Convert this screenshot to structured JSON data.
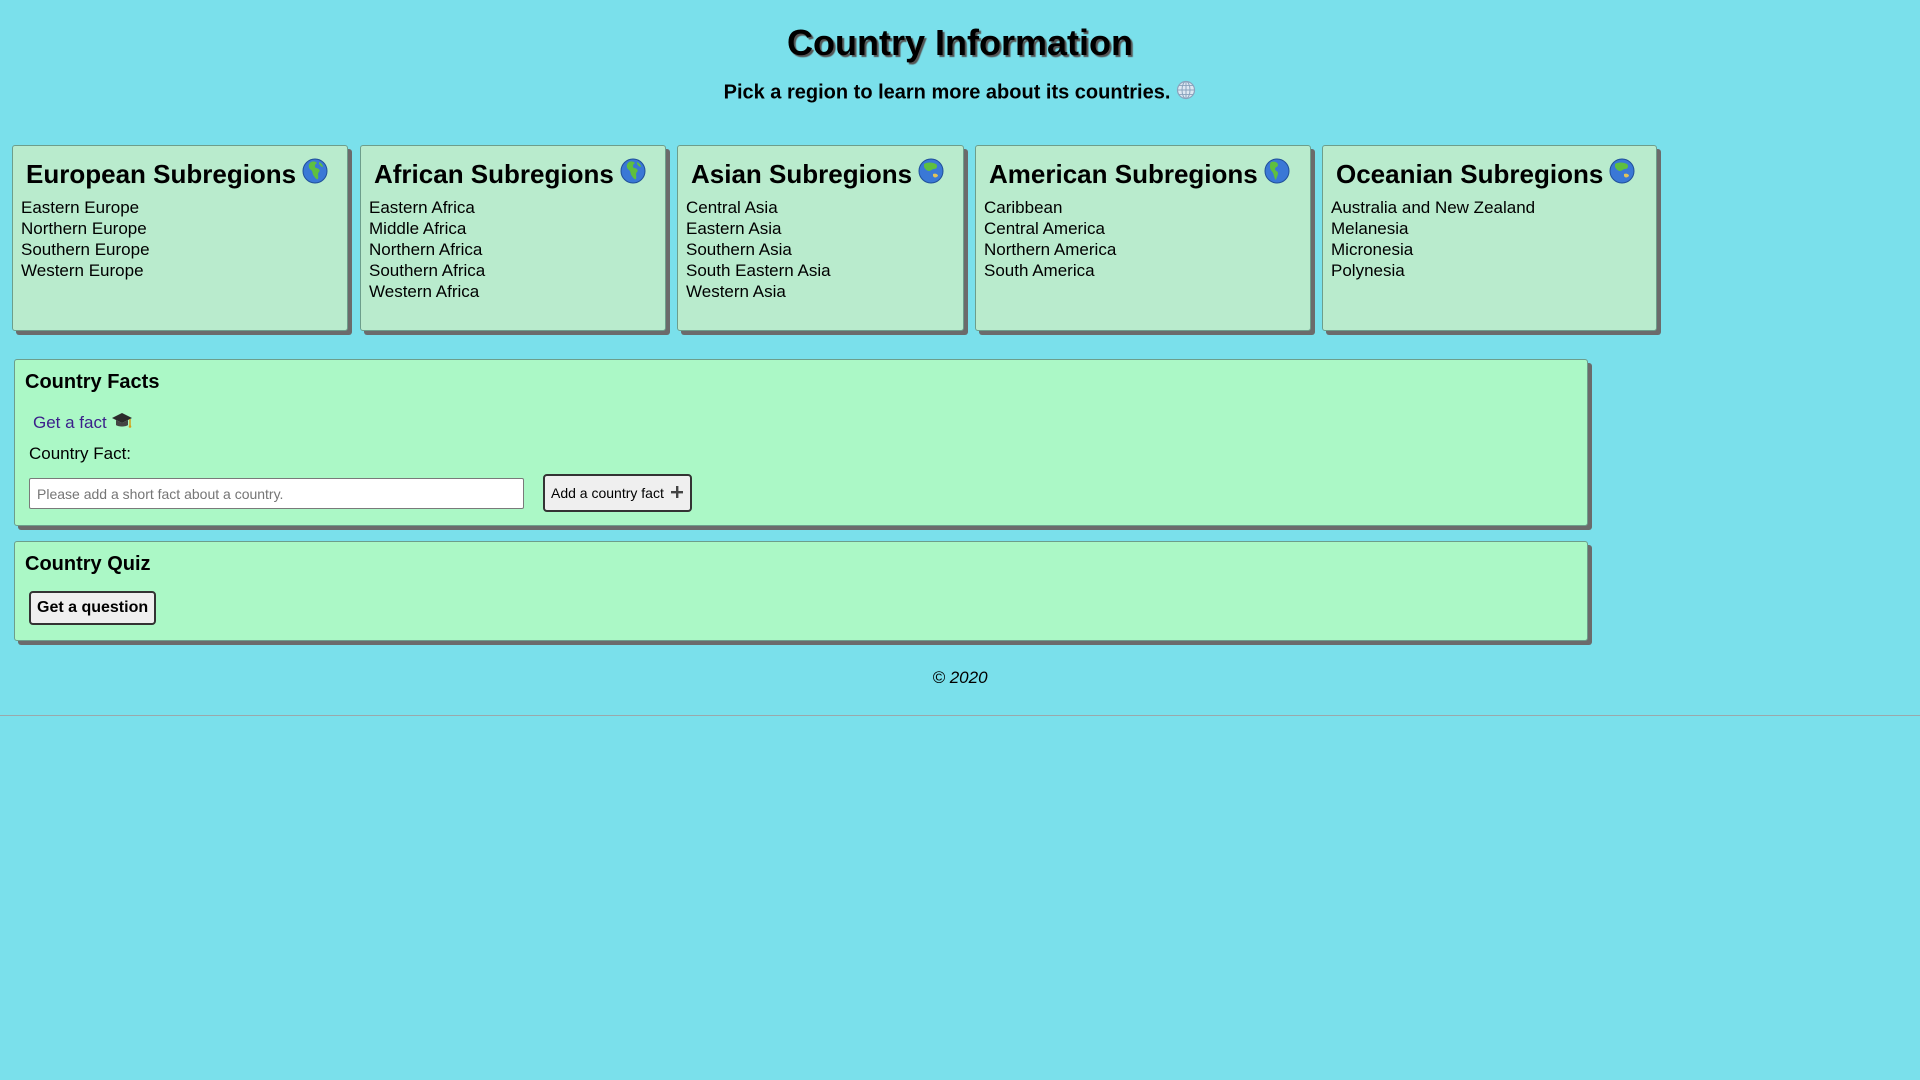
{
  "header": {
    "title": "Country Information",
    "subtitle": "Pick a region to learn more about its countries."
  },
  "regions": [
    {
      "title": "European Subregions",
      "icon": "earth-africa-europe-icon",
      "items": [
        "Eastern Europe",
        "Northern Europe",
        "Southern Europe",
        "Western Europe"
      ]
    },
    {
      "title": "African Subregions",
      "icon": "earth-africa-europe-icon",
      "items": [
        "Eastern Africa",
        "Middle Africa",
        "Northern Africa",
        "Southern Africa",
        "Western Africa"
      ]
    },
    {
      "title": "Asian Subregions",
      "icon": "earth-asia-icon",
      "items": [
        "Central Asia",
        "Eastern Asia",
        "Southern Asia",
        "South Eastern Asia",
        "Western Asia"
      ]
    },
    {
      "title": "American Subregions",
      "icon": "earth-americas-icon",
      "items": [
        "Caribbean",
        "Central America",
        "Northern America",
        "South America"
      ]
    },
    {
      "title": "Oceanian Subregions",
      "icon": "earth-asia-icon",
      "items": [
        "Australia and New Zealand",
        "Melanesia",
        "Micronesia",
        "Polynesia"
      ]
    }
  ],
  "facts": {
    "heading": "Country Facts",
    "link_label": "Get a fact",
    "field_label": "Country Fact:",
    "input_placeholder": "Please add a short fact about a country.",
    "input_value": "",
    "add_button_label": "Add a country fact"
  },
  "quiz": {
    "heading": "Country Quiz",
    "button_label": "Get a question"
  },
  "footer": {
    "copyright": "© 2020"
  },
  "colors": {
    "page_background": "#7ae0eb",
    "region_card": "#b9ebcd",
    "section_background": "#abf8c6",
    "link": "#3b1f8a"
  }
}
